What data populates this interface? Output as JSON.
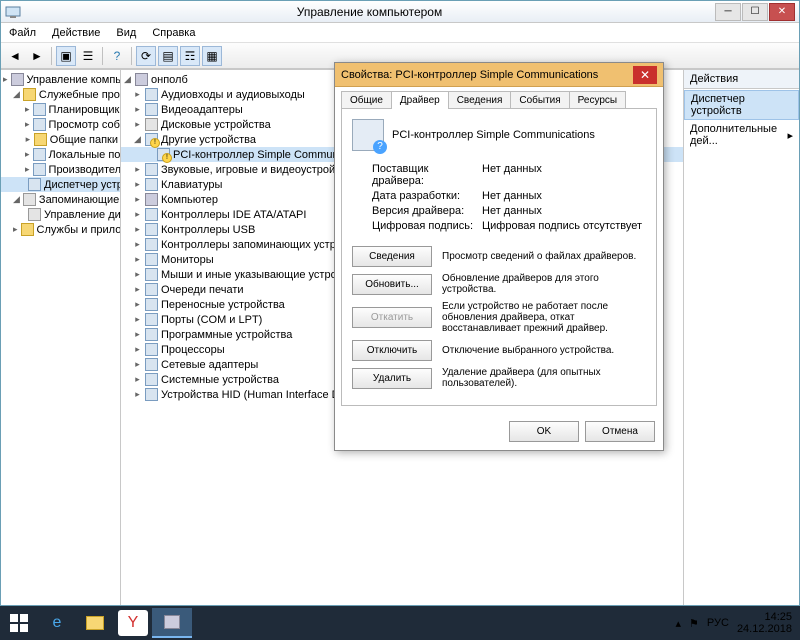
{
  "window": {
    "title": "Управление компьютером"
  },
  "menu": {
    "file": "Файл",
    "action": "Действие",
    "view": "Вид",
    "help": "Справка"
  },
  "left_tree": {
    "root": "Управление компьютером (л",
    "sys": "Служебные программы",
    "sched": "Планировщик заданий",
    "evt": "Просмотр событий",
    "share": "Общие папки",
    "users": "Локальные пользовате",
    "perf": "Производительность",
    "devmgr": "Диспетчер устройств",
    "storage": "Запоминающие устройст",
    "diskmgmt": "Управление дисками",
    "services": "Службы и приложения"
  },
  "mid_tree": {
    "root": "онполб",
    "audio": "Аудиовходы и аудиовыходы",
    "video": "Видеоадаптеры",
    "diskdrv": "Дисковые устройства",
    "other": "Другие устройства",
    "pci": "PCI-контроллер Simple Communications",
    "sound": "Звуковые, игровые и видеоустройства",
    "keyb": "Клавиатуры",
    "comp": "Компьютер",
    "ide": "Контроллеры IDE ATA/ATAPI",
    "usb": "Контроллеры USB",
    "stor": "Контроллеры запоминающих устройств",
    "mon": "Мониторы",
    "mice": "Мыши и иные указывающие устройства",
    "prnq": "Очереди печати",
    "portable": "Переносные устройства",
    "ports": "Порты (COM и LPT)",
    "soft": "Программные устройства",
    "cpu": "Процессоры",
    "net": "Сетевые адаптеры",
    "sysdev": "Системные устройства",
    "hid": "Устройства HID (Human Interface Devices)"
  },
  "right": {
    "header": "Действия",
    "selected": "Диспетчер устройств",
    "more": "Дополнительные дей..."
  },
  "dialog": {
    "title": "Свойства: PCI-контроллер Simple Communications",
    "tabs": {
      "general": "Общие",
      "driver": "Драйвер",
      "details": "Сведения",
      "events": "События",
      "resources": "Ресурсы"
    },
    "devname": "PCI-контроллер Simple Communications",
    "kv": {
      "provider_k": "Поставщик драйвера:",
      "provider_v": "Нет данных",
      "date_k": "Дата разработки:",
      "date_v": "Нет данных",
      "ver_k": "Версия драйвера:",
      "ver_v": "Нет данных",
      "sig_k": "Цифровая подпись:",
      "sig_v": "Цифровая подпись отсутствует"
    },
    "btns": {
      "details": "Сведения",
      "details_d": "Просмотр сведений о файлах драйверов.",
      "update": "Обновить...",
      "update_d": "Обновление драйверов для этого устройства.",
      "rollback": "Откатить",
      "rollback_d": "Если устройство не работает после обновления драйвера, откат восстанавливает прежний драйвер.",
      "disable": "Отключить",
      "disable_d": "Отключение выбранного устройства.",
      "remove": "Удалить",
      "remove_d": "Удаление драйвера (для опытных пользователей)."
    },
    "ok": "OK",
    "cancel": "Отмена"
  },
  "tray": {
    "lang": "РУС",
    "time": "14:25",
    "date": "24.12.2018"
  }
}
